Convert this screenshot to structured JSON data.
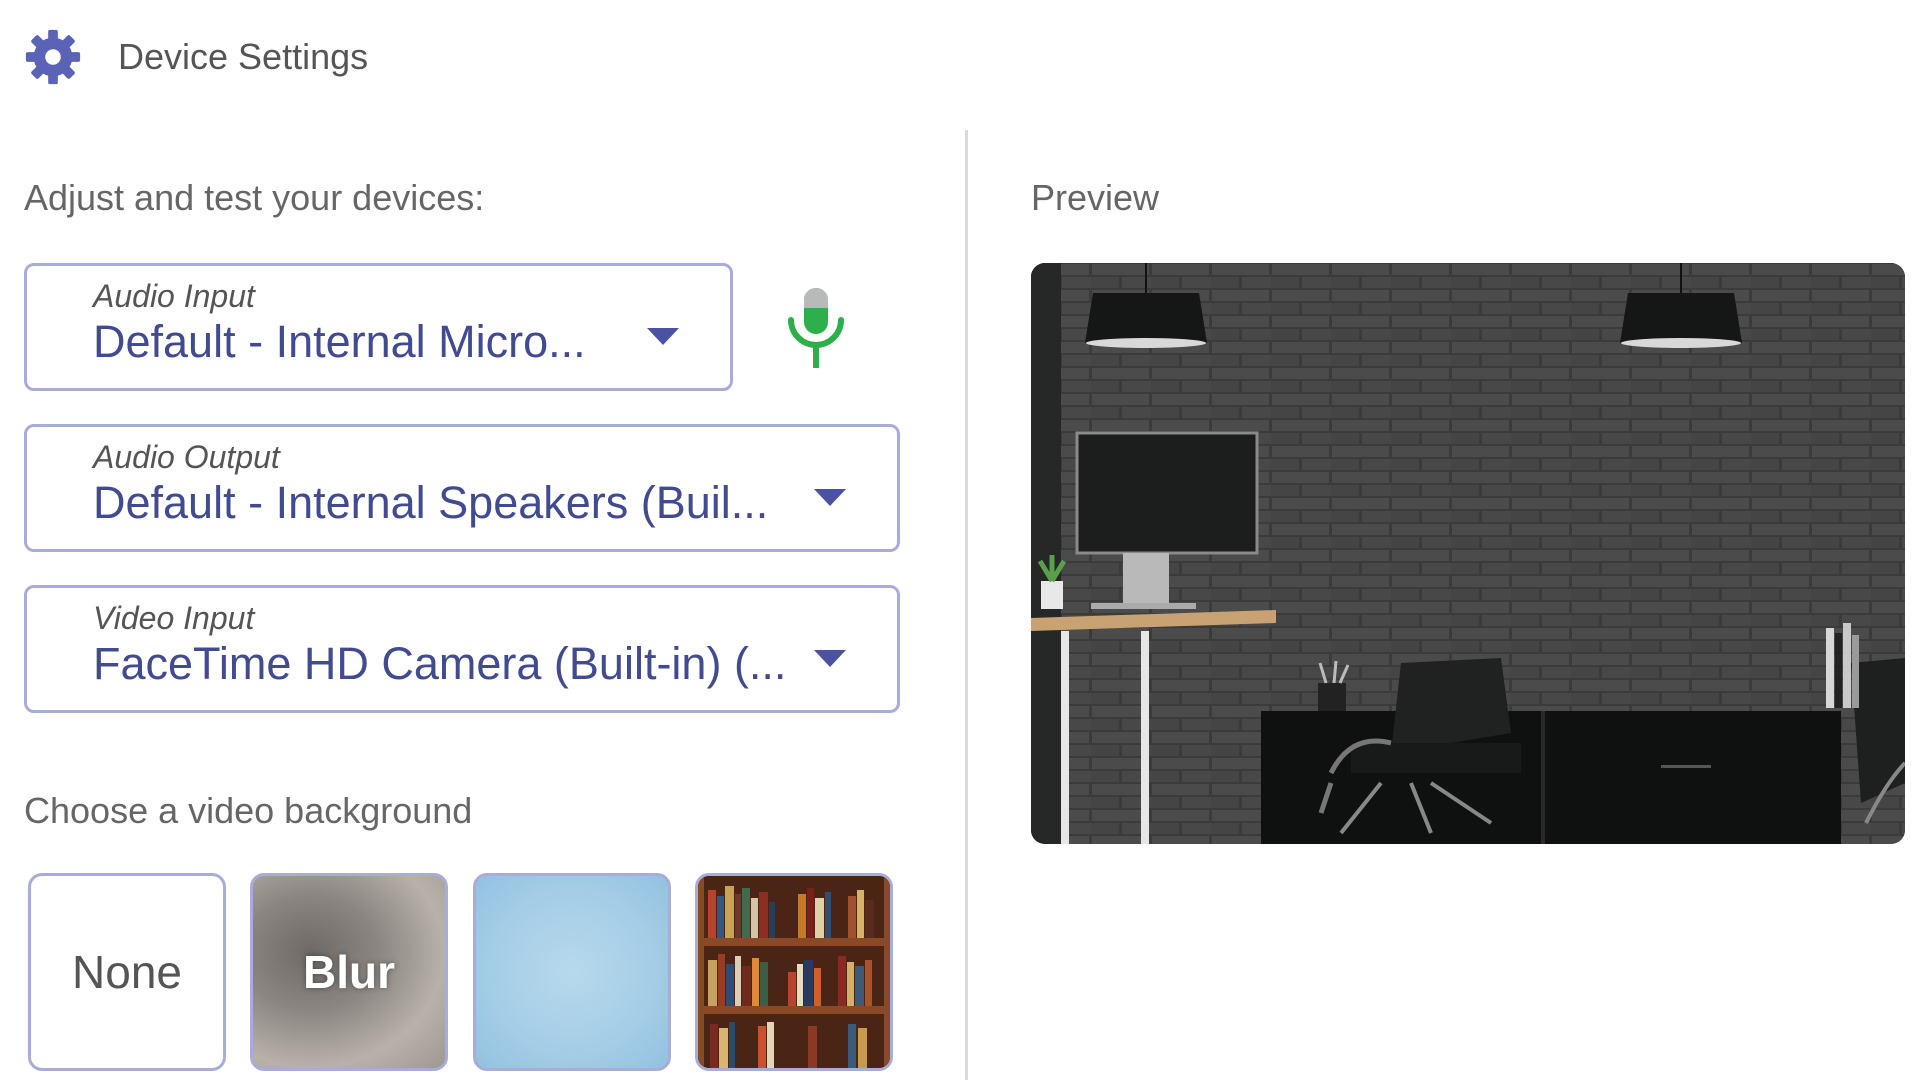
{
  "header": {
    "title": "Device Settings",
    "icon": "gear-icon"
  },
  "left": {
    "intro_label": "Adjust and test your devices:",
    "audio_input": {
      "caption": "Audio Input",
      "value": "Default - Internal Micro...",
      "icon": "microphone-icon",
      "mic_color": "#2db04b"
    },
    "audio_output": {
      "caption": "Audio Output",
      "value": "Default - Internal Speakers (Buil..."
    },
    "video_input": {
      "caption": "Video Input",
      "value": "FaceTime HD Camera (Built-in) (..."
    },
    "background_label": "Choose a video background",
    "backgrounds": [
      {
        "label": "None"
      },
      {
        "label": "Blur"
      },
      {
        "label": ""
      },
      {
        "label": ""
      }
    ]
  },
  "right": {
    "preview_label": "Preview"
  },
  "colors": {
    "accent": "#4b52a3",
    "border": "#a7acd8",
    "gear": "#5b63b7"
  }
}
